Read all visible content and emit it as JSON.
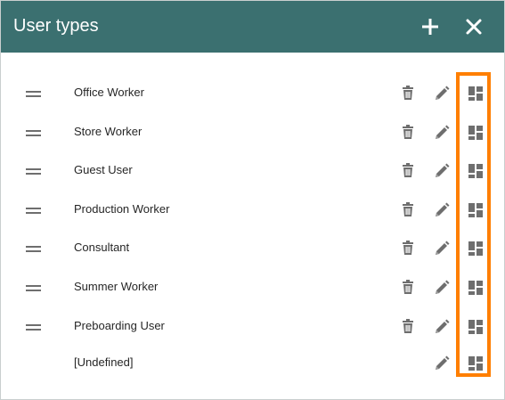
{
  "dialog": {
    "title": "User types",
    "add_icon": "plus-icon",
    "close_icon": "close-icon"
  },
  "colors": {
    "header_bg": "#3b7070",
    "header_fg": "#ffffff",
    "icon_gray": "#6e6e6e",
    "highlight": "#ff7f00"
  },
  "user_types": [
    {
      "label": "Office Worker",
      "draggable": true,
      "deletable": true
    },
    {
      "label": "Store Worker",
      "draggable": true,
      "deletable": true
    },
    {
      "label": "Guest User",
      "draggable": true,
      "deletable": true
    },
    {
      "label": "Production Worker",
      "draggable": true,
      "deletable": true
    },
    {
      "label": "Consultant",
      "draggable": true,
      "deletable": true
    },
    {
      "label": "Summer Worker",
      "draggable": true,
      "deletable": true
    },
    {
      "label": "Preboarding User",
      "draggable": true,
      "deletable": true
    },
    {
      "label": "[Undefined]",
      "draggable": false,
      "deletable": false
    }
  ],
  "row_icons": {
    "drag": "drag-handle-icon",
    "delete": "trash-icon",
    "edit": "pencil-icon",
    "layout": "dashboard-layout-icon"
  }
}
